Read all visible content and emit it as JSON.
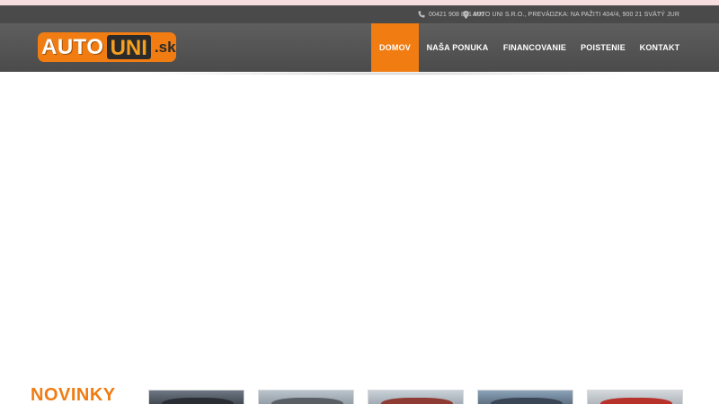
{
  "topbar": {
    "phone": "00421 908 881 999",
    "address": "AUTO UNI S.R.O., PREVÁDZKA: NA PAŽITI 404/4, 900 21 SVÄTÝ JUR"
  },
  "logo": {
    "part1": "AUTO",
    "part2": "UNI",
    "part3": ".sk"
  },
  "nav": [
    {
      "label": "DOMOV",
      "active": true
    },
    {
      "label": "NAŠA PONUKA",
      "active": false
    },
    {
      "label": "FINANCOVANIE",
      "active": false
    },
    {
      "label": "POISTENIE",
      "active": false
    },
    {
      "label": "KONTAKT",
      "active": false
    }
  ],
  "news": {
    "title": "NOVINKY"
  },
  "colors": {
    "accent": "#f07c12",
    "header_bg": "#555555",
    "topbar_bg": "#4a4a4a",
    "pink_strip": "#f7dede"
  }
}
